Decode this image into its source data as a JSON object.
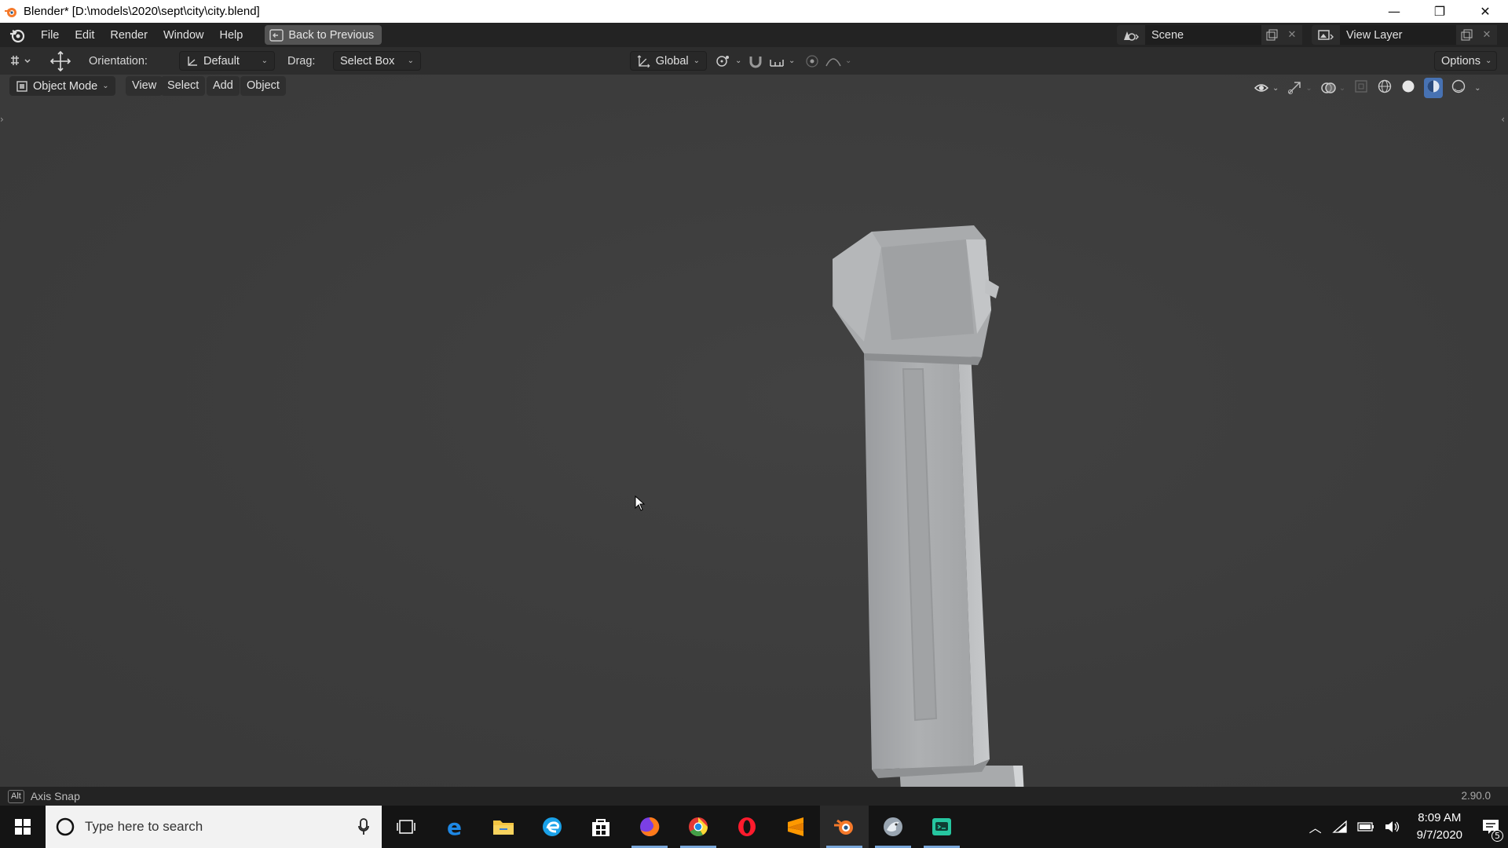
{
  "window": {
    "title": "Blender* [D:\\models\\2020\\sept\\city\\city.blend]",
    "controls": [
      "minimize",
      "restore",
      "close"
    ]
  },
  "topbar": {
    "menus": [
      "File",
      "Edit",
      "Render",
      "Window",
      "Help"
    ],
    "back_button": "Back to Previous",
    "scene_name": "Scene",
    "view_layer_name": "View Layer"
  },
  "tool_header": {
    "orientation_label": "Orientation:",
    "orientation_value": "Default",
    "drag_label": "Drag:",
    "drag_value": "Select Box",
    "transform_orientation": "Global",
    "options_label": "Options"
  },
  "viewport_header": {
    "mode": "Object Mode",
    "menus": [
      "View",
      "Select",
      "Add",
      "Object"
    ]
  },
  "statusbar": {
    "key": "Alt",
    "hint": "Axis Snap",
    "version": "2.90.0"
  },
  "taskbar": {
    "search_placeholder": "Type here to search",
    "apps": [
      "task-view",
      "internet-explorer",
      "file-explorer",
      "edge",
      "store",
      "firefox",
      "chrome",
      "opera",
      "sublime-text",
      "blender",
      "bird-app",
      "terminal-app"
    ],
    "time": "8:09 AM",
    "date": "9/7/2020",
    "notifications": "5"
  },
  "colors": {
    "viewport_bg": "#3d3d3d",
    "header_bg": "#232323",
    "tool_header_bg": "#2d2d2d",
    "model_gray": "#a9abad",
    "accent_blue": "#4772b3"
  }
}
